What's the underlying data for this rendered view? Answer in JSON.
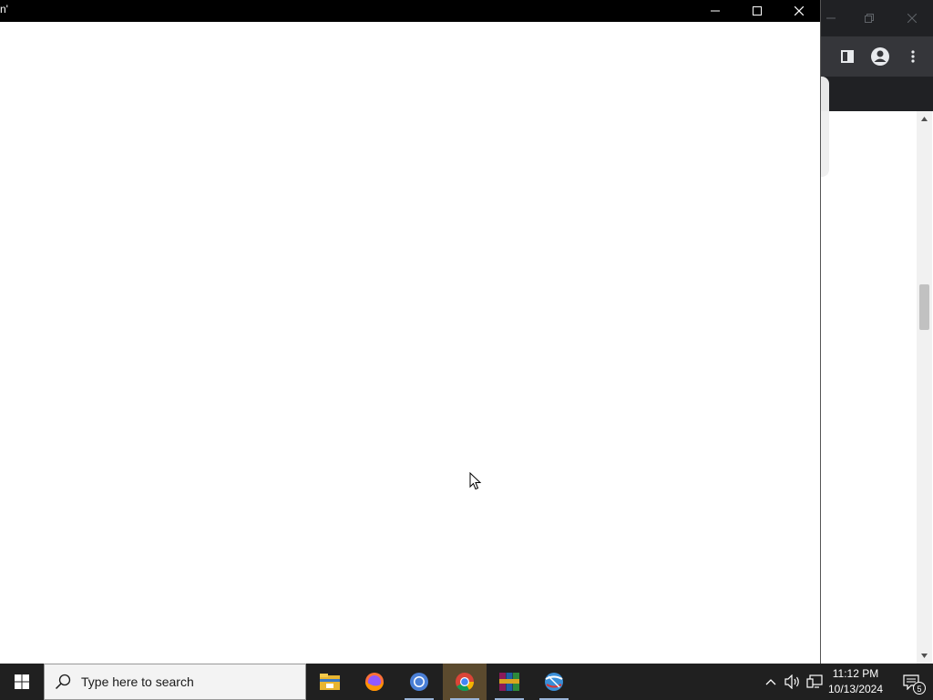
{
  "foreground_window": {
    "title": "n'",
    "minimize_icon": "minimize-icon",
    "maximize_icon": "maximize-icon",
    "close_icon": "close-icon"
  },
  "background_window": {
    "app": "chrome",
    "toolbar_icons": [
      "side-panel-icon",
      "profile-icon",
      "more-menu-icon"
    ]
  },
  "taskbar": {
    "search_placeholder": "Type here to search",
    "apps": [
      {
        "name": "file-explorer",
        "active": false
      },
      {
        "name": "firefox",
        "active": false
      },
      {
        "name": "chromium",
        "active": false
      },
      {
        "name": "chrome",
        "active": true
      },
      {
        "name": "winrar",
        "active": false
      },
      {
        "name": "network-app",
        "active": false
      }
    ],
    "clock": {
      "time": "11:12 PM",
      "date": "10/13/2024"
    },
    "notification_count": "5"
  },
  "colors": {
    "titlebar": "#000000",
    "taskbar": "#202020",
    "chrome_dark": "#202124",
    "active_app": "#5b4a2e"
  }
}
